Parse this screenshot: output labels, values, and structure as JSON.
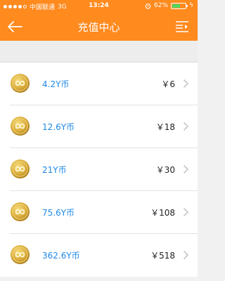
{
  "status": {
    "carrier": "中国联通",
    "network": "3G",
    "time": "13:24",
    "battery": "62%",
    "battery_level": 0.62,
    "signal_bars": 4
  },
  "nav": {
    "back_icon": "arrow-left-icon",
    "title": "充值中心",
    "menu_icon": "list-menu-icon"
  },
  "items": [
    {
      "label": "4.2Y币",
      "price": "￥6"
    },
    {
      "label": "12.6Y币",
      "price": "￥18"
    },
    {
      "label": "21Y币",
      "price": "￥30"
    },
    {
      "label": "75.6Y币",
      "price": "￥108"
    },
    {
      "label": "362.6Y币",
      "price": "￥518"
    }
  ],
  "colors": {
    "accent": "#ff8a1e",
    "link": "#1e88e5",
    "coin": "#d4a632"
  }
}
